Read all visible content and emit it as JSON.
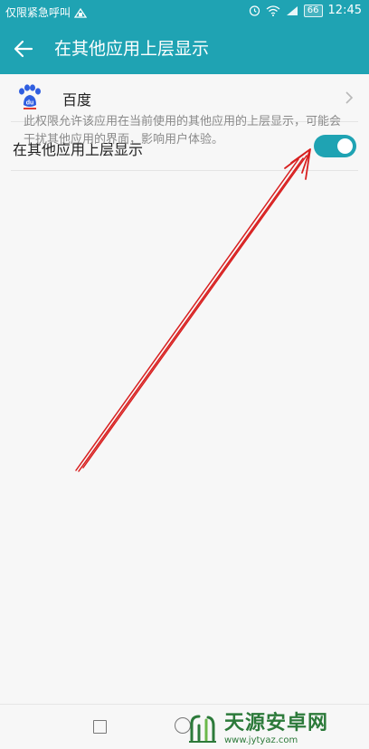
{
  "status_bar": {
    "carrier_text": "仅限紧急呼叫",
    "battery": "66",
    "time": "12:45"
  },
  "header": {
    "title": "在其他应用上层显示"
  },
  "app_row": {
    "name": "百度",
    "icon": "baidu-app-icon"
  },
  "toggle_row": {
    "label": "在其他应用上层显示",
    "checked": true
  },
  "description": "此权限允许该应用在当前使用的其他应用的上层显示，可能会干扰其他应用的界面，影响用户体验。",
  "watermark": {
    "brand": "天源安卓网",
    "url": "www.jytyaz.com"
  },
  "colors": {
    "accent": "#1fa3b3",
    "annotation_arrow": "#d81f1f"
  }
}
